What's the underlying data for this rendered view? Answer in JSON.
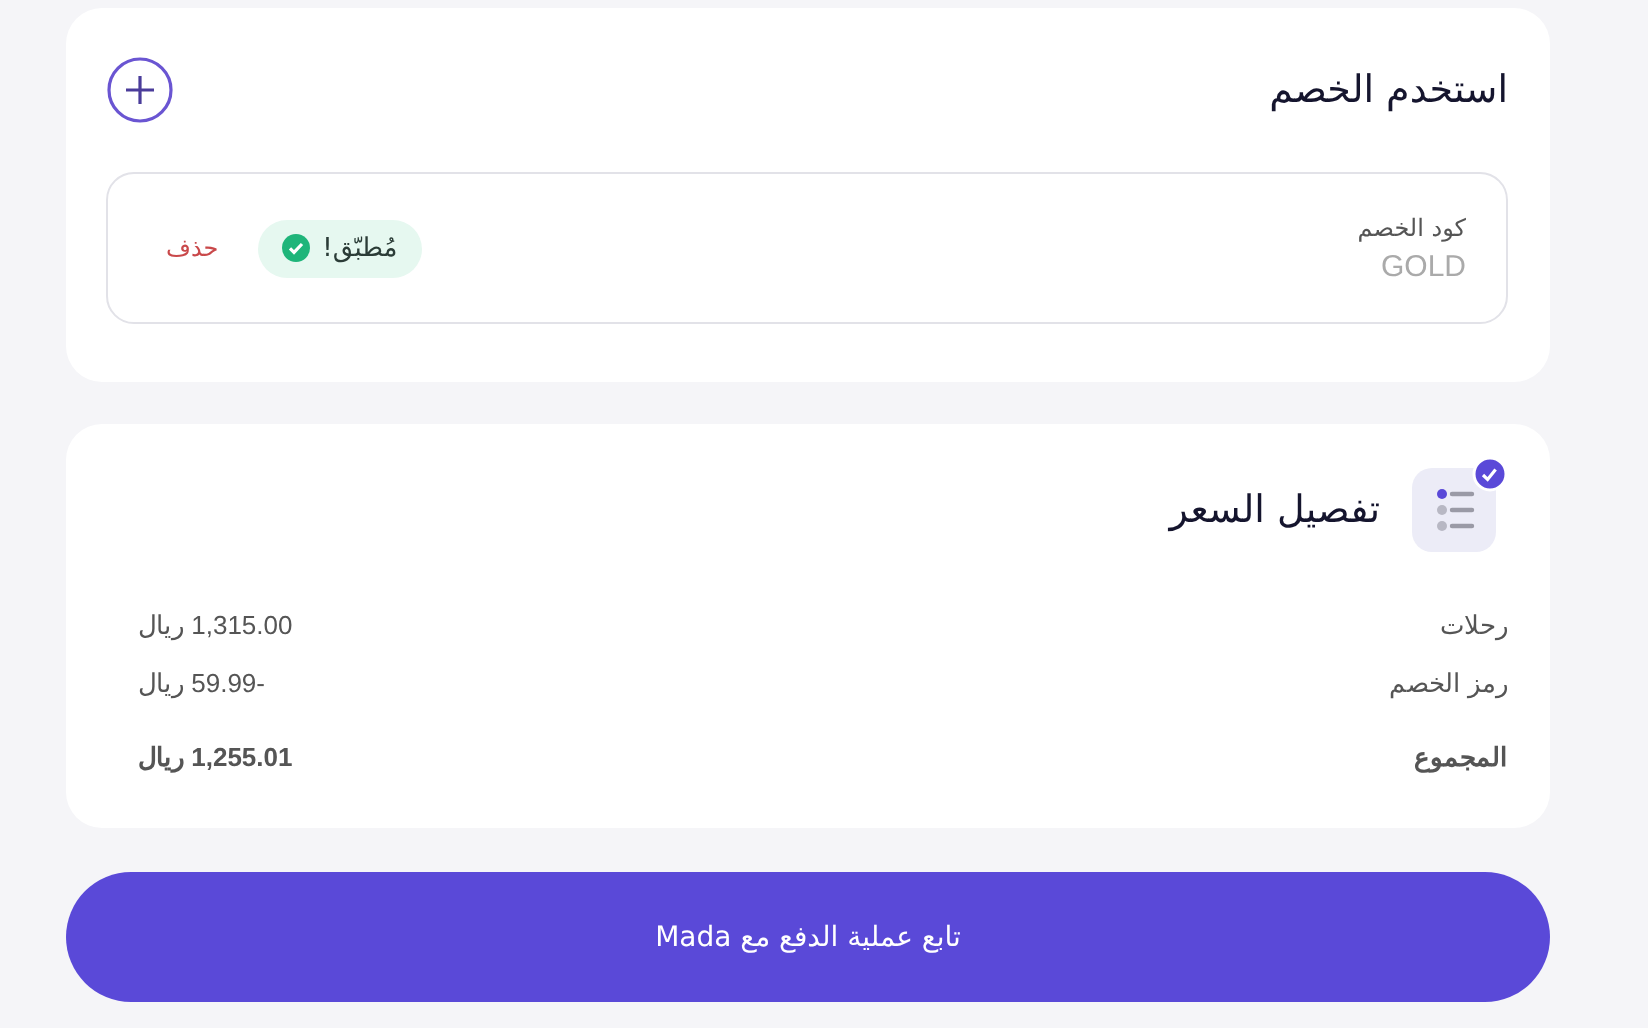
{
  "discount": {
    "title": "استخدم الخصم",
    "code_label": "كود الخصم",
    "code_value": "GOLD",
    "status": "مُطبّق!",
    "remove": "حذف"
  },
  "price": {
    "title": "تفصيل السعر",
    "rows": [
      {
        "kind": "item",
        "label": "رحلات",
        "amount": "1,315.00 ريال"
      },
      {
        "kind": "item",
        "label": "رمز الخصم",
        "amount": "-59.99 ريال"
      },
      {
        "kind": "total",
        "label": "المجموع",
        "amount": "1,255.01 ريال"
      }
    ]
  },
  "pay_button": "تابع عملية الدفع مع Mada"
}
